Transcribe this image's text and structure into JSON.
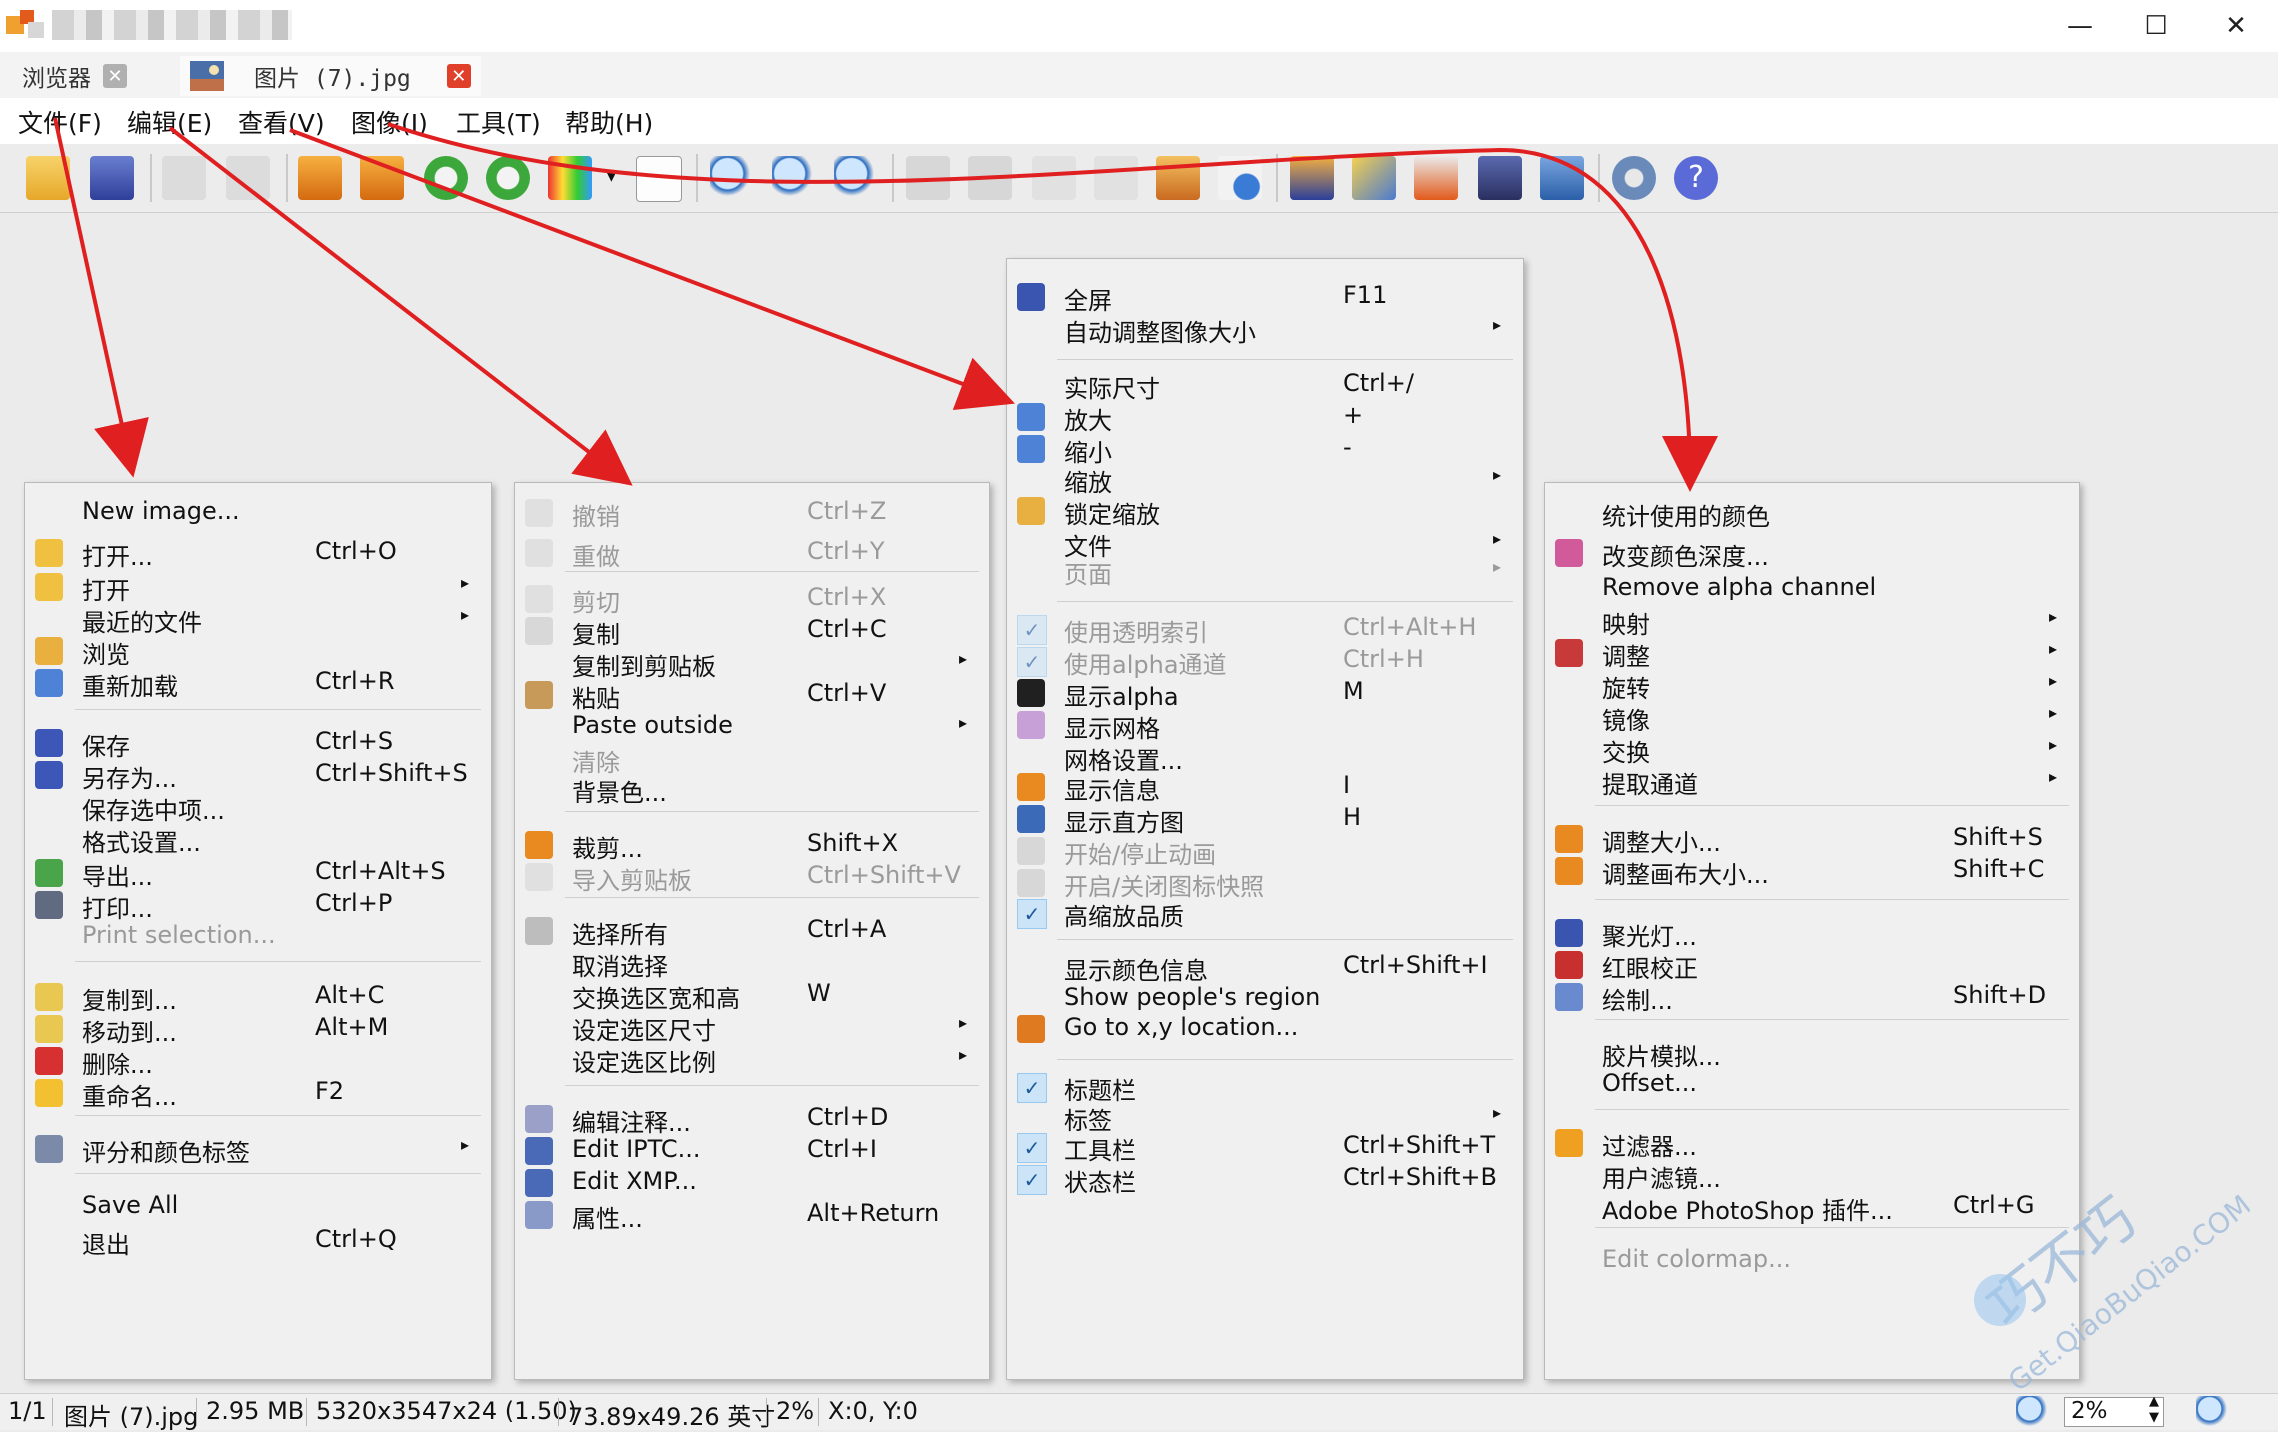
{
  "window": {
    "minimize": "—",
    "maximize": "☐",
    "close": "✕"
  },
  "tabs": [
    {
      "label": "浏览器",
      "close_color": "#b0b0b0"
    },
    {
      "label": "图片 (7).jpg",
      "close_color": "#e0402a"
    }
  ],
  "menubar": [
    "文件(F)",
    "编辑(E)",
    "查看(V)",
    "图像(I)",
    "工具(T)",
    "帮助(H)"
  ],
  "file_menu": [
    {
      "label": "New image...",
      "shortcut": ""
    },
    {
      "label": "打开...",
      "shortcut": "Ctrl+O"
    },
    {
      "label": "打开",
      "shortcut": "",
      "submenu": true
    },
    {
      "label": "最近的文件",
      "shortcut": "",
      "submenu": true
    },
    {
      "label": "浏览",
      "shortcut": ""
    },
    {
      "label": "重新加载",
      "shortcut": "Ctrl+R"
    },
    {
      "label": "保存",
      "shortcut": "Ctrl+S"
    },
    {
      "label": "另存为...",
      "shortcut": "Ctrl+Shift+S"
    },
    {
      "label": "保存选中项...",
      "shortcut": ""
    },
    {
      "label": "格式设置...",
      "shortcut": ""
    },
    {
      "label": "导出...",
      "shortcut": "Ctrl+Alt+S"
    },
    {
      "label": "打印...",
      "shortcut": "Ctrl+P"
    },
    {
      "label": "Print selection...",
      "shortcut": "",
      "disabled": true
    },
    {
      "label": "复制到...",
      "shortcut": "Alt+C"
    },
    {
      "label": "移动到...",
      "shortcut": "Alt+M"
    },
    {
      "label": "删除...",
      "shortcut": ""
    },
    {
      "label": "重命名...",
      "shortcut": "F2"
    },
    {
      "label": "评分和颜色标签",
      "shortcut": "",
      "submenu": true
    },
    {
      "label": "Save All",
      "shortcut": ""
    },
    {
      "label": "退出",
      "shortcut": "Ctrl+Q"
    }
  ],
  "edit_menu": [
    {
      "label": "撤销",
      "shortcut": "Ctrl+Z",
      "disabled": true
    },
    {
      "label": "重做",
      "shortcut": "Ctrl+Y",
      "disabled": true
    },
    {
      "label": "剪切",
      "shortcut": "Ctrl+X",
      "disabled": true
    },
    {
      "label": "复制",
      "shortcut": "Ctrl+C"
    },
    {
      "label": "复制到剪贴板",
      "shortcut": "",
      "submenu": true
    },
    {
      "label": "粘贴",
      "shortcut": "Ctrl+V"
    },
    {
      "label": "Paste outside",
      "shortcut": "",
      "submenu": true
    },
    {
      "label": "清除",
      "shortcut": "",
      "disabled": true
    },
    {
      "label": "背景色...",
      "shortcut": ""
    },
    {
      "label": "裁剪...",
      "shortcut": "Shift+X"
    },
    {
      "label": "导入剪贴板",
      "shortcut": "Ctrl+Shift+V",
      "disabled": true
    },
    {
      "label": "选择所有",
      "shortcut": "Ctrl+A"
    },
    {
      "label": "取消选择",
      "shortcut": ""
    },
    {
      "label": "交换选区宽和高",
      "shortcut": "W"
    },
    {
      "label": "设定选区尺寸",
      "shortcut": "",
      "submenu": true
    },
    {
      "label": "设定选区比例",
      "shortcut": "",
      "submenu": true
    },
    {
      "label": "编辑注释...",
      "shortcut": "Ctrl+D"
    },
    {
      "label": "Edit IPTC...",
      "shortcut": "Ctrl+I"
    },
    {
      "label": "Edit XMP...",
      "shortcut": ""
    },
    {
      "label": "属性...",
      "shortcut": "Alt+Return"
    }
  ],
  "view_menu": [
    {
      "label": "全屏",
      "shortcut": "F11"
    },
    {
      "label": "自动调整图像大小",
      "shortcut": "",
      "submenu": true
    },
    {
      "label": "实际尺寸",
      "shortcut": "Ctrl+/"
    },
    {
      "label": "放大",
      "shortcut": "+"
    },
    {
      "label": "缩小",
      "shortcut": "-"
    },
    {
      "label": "缩放",
      "shortcut": "",
      "submenu": true
    },
    {
      "label": "锁定缩放",
      "shortcut": ""
    },
    {
      "label": "文件",
      "shortcut": "",
      "submenu": true
    },
    {
      "label": "页面",
      "shortcut": "",
      "submenu": true,
      "disabled": true
    },
    {
      "label": "使用透明索引",
      "shortcut": "Ctrl+Alt+H",
      "disabled": true
    },
    {
      "label": "使用alpha通道",
      "shortcut": "Ctrl+H",
      "disabled": true
    },
    {
      "label": "显示alpha",
      "shortcut": "M"
    },
    {
      "label": "显示网格",
      "shortcut": ""
    },
    {
      "label": "网格设置...",
      "shortcut": ""
    },
    {
      "label": "显示信息",
      "shortcut": "I"
    },
    {
      "label": "显示直方图",
      "shortcut": "H"
    },
    {
      "label": "开始/停止动画",
      "shortcut": "",
      "disabled": true
    },
    {
      "label": "开启/关闭图标快照",
      "shortcut": "",
      "disabled": true
    },
    {
      "label": "高缩放品质",
      "shortcut": ""
    },
    {
      "label": "显示颜色信息",
      "shortcut": "Ctrl+Shift+I"
    },
    {
      "label": "Show people's region",
      "shortcut": ""
    },
    {
      "label": "Go to x,y location...",
      "shortcut": ""
    },
    {
      "label": "标题栏",
      "shortcut": ""
    },
    {
      "label": "标签",
      "shortcut": "",
      "submenu": true
    },
    {
      "label": "工具栏",
      "shortcut": "Ctrl+Shift+T"
    },
    {
      "label": "状态栏",
      "shortcut": "Ctrl+Shift+B"
    }
  ],
  "image_menu": [
    {
      "label": "统计使用的颜色",
      "shortcut": ""
    },
    {
      "label": "改变颜色深度...",
      "shortcut": ""
    },
    {
      "label": "Remove alpha channel",
      "shortcut": ""
    },
    {
      "label": "映射",
      "shortcut": "",
      "submenu": true
    },
    {
      "label": "调整",
      "shortcut": "",
      "submenu": true
    },
    {
      "label": "旋转",
      "shortcut": "",
      "submenu": true
    },
    {
      "label": "镜像",
      "shortcut": "",
      "submenu": true
    },
    {
      "label": "交换",
      "shortcut": "",
      "submenu": true
    },
    {
      "label": "提取通道",
      "shortcut": "",
      "submenu": true
    },
    {
      "label": "调整大小...",
      "shortcut": "Shift+S"
    },
    {
      "label": "调整画布大小...",
      "shortcut": "Shift+C"
    },
    {
      "label": "聚光灯...",
      "shortcut": ""
    },
    {
      "label": "红眼校正",
      "shortcut": ""
    },
    {
      "label": "绘制...",
      "shortcut": "Shift+D"
    },
    {
      "label": "胶片模拟...",
      "shortcut": ""
    },
    {
      "label": "Offset...",
      "shortcut": ""
    },
    {
      "label": "过滤器...",
      "shortcut": ""
    },
    {
      "label": "用户滤镜...",
      "shortcut": ""
    },
    {
      "label": "Adobe PhotoShop 插件...",
      "shortcut": "Ctrl+G"
    },
    {
      "label": "Edit colormap...",
      "shortcut": "",
      "disabled": true
    }
  ],
  "status": {
    "index": "1/1",
    "filename": "图片 (7).jpg",
    "filesize": "2.95 MB",
    "dimensions": "5320x3547x24 (1.50)",
    "print_size": "73.89x49.26 英寸",
    "zoom": "2%",
    "coords": "X:0, Y:0",
    "zoom_value": "2%"
  },
  "watermark": {
    "brand": "巧不巧",
    "url": "Get.QiaoBuQiao.COM"
  },
  "colors": {
    "annotation_arrow": "#e02020",
    "menu_bg": "#f0f0f0",
    "checked_bg": "#cce4f7"
  }
}
